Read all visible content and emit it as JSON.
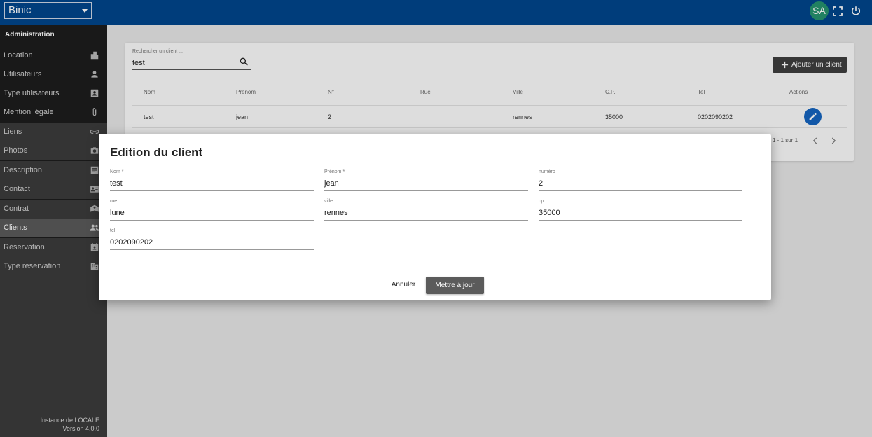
{
  "topbar": {
    "site": "Binic",
    "avatar": "SA",
    "icons": [
      "fullscreen-icon",
      "power-icon"
    ]
  },
  "sidebar": {
    "header": "Administration",
    "items": [
      {
        "label": "Location",
        "icon": "city-icon"
      },
      {
        "label": "Utilisateurs",
        "icon": "person-icon"
      },
      {
        "label": "Type utilisateurs",
        "icon": "contact-card-icon"
      },
      {
        "label": "Mention légale",
        "icon": "paperclip-icon"
      },
      {
        "label": "Liens",
        "icon": "link-icon"
      },
      {
        "label": "Photos",
        "icon": "camera-icon"
      },
      {
        "label": "Description",
        "icon": "description-icon"
      },
      {
        "label": "Contact",
        "icon": "contact-icon"
      },
      {
        "label": "Contrat",
        "icon": "contract-icon"
      },
      {
        "label": "Clients",
        "icon": "group-icon",
        "active": true
      },
      {
        "label": "Réservation",
        "icon": "calendar-icon"
      },
      {
        "label": "Type réservation",
        "icon": "building-icon"
      }
    ],
    "footer": {
      "instance": "Instance de LOCALE",
      "version": "Version 4.0.0"
    }
  },
  "search": {
    "label": "Rechercher un client ...",
    "value": "test"
  },
  "add_button": "Ajouter un client",
  "table": {
    "headers": [
      "Nom",
      "Prenom",
      "N°",
      "Rue",
      "Ville",
      "C.P.",
      "Tel",
      "Actions"
    ],
    "rows": [
      {
        "nom": "test",
        "prenom": "jean",
        "numero": "2",
        "rue": "",
        "ville": "rennes",
        "cp": "35000",
        "tel": "0202090202"
      }
    ],
    "pager": "1 - 1 sur 1"
  },
  "dialog": {
    "title": "Edition du client",
    "fields": {
      "nom": {
        "label": "Nom *",
        "value": "test"
      },
      "prenom": {
        "label": "Prénom *",
        "value": "jean"
      },
      "numero": {
        "label": "numéro",
        "value": "2"
      },
      "rue": {
        "label": "rue",
        "value": "lune"
      },
      "ville": {
        "label": "ville",
        "value": "rennes"
      },
      "cp": {
        "label": "cp",
        "value": "35000"
      },
      "tel": {
        "label": "tel",
        "value": "0202090202"
      }
    },
    "cancel": "Annuler",
    "submit": "Mettre à jour"
  },
  "colors": {
    "topbar": "#00468c",
    "sidebar": "#1d1d1d",
    "avatar": "#26936f",
    "edit_button": "#1565c0"
  }
}
